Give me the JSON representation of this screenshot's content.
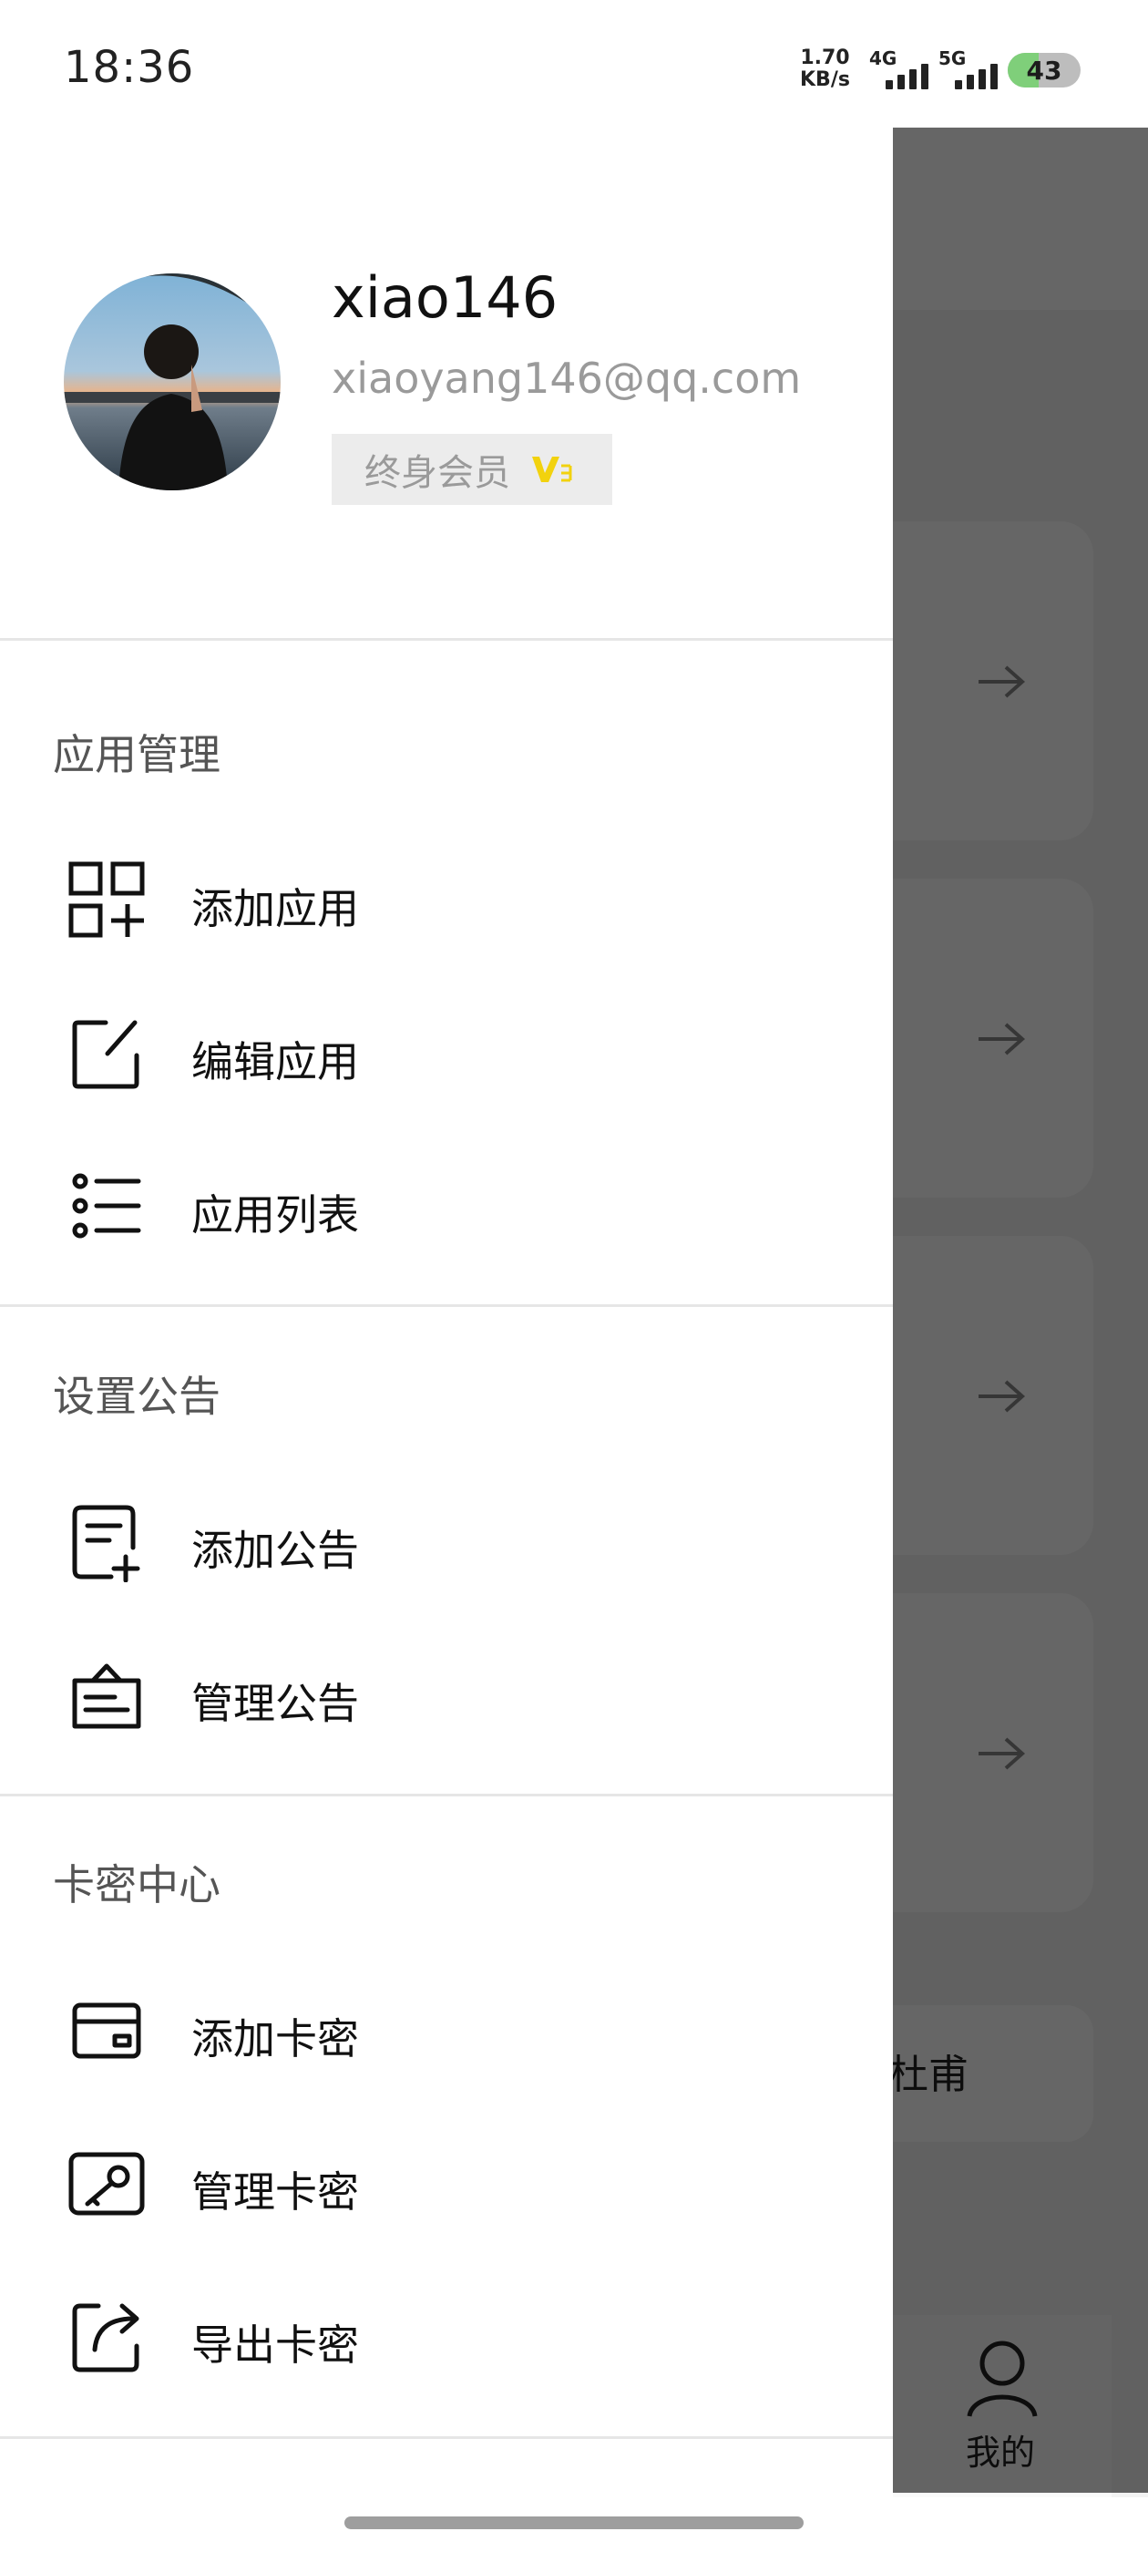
{
  "status_bar": {
    "time": "18:36",
    "net_speed_value": "1.70",
    "net_speed_unit": "KB/s",
    "signal_1_label": "4G",
    "signal_2_label": "5G",
    "battery_level": "43",
    "battery_fill_percent": 43,
    "battery_color": "#7fcf7a"
  },
  "background_page": {
    "card_text": "杜甫",
    "nav_label": "我的",
    "nav_icon": "person-icon"
  },
  "drawer": {
    "profile": {
      "username": "xiao146",
      "email": "xiaoyang146@qq.com",
      "membership": "终身会员",
      "vip_icon": "vip-badge-icon",
      "vip_color": "#f2d20e"
    },
    "sections": [
      {
        "title": "应用管理",
        "items": [
          {
            "label": "添加应用",
            "icon": "grid-add-icon"
          },
          {
            "label": "编辑应用",
            "icon": "edit-icon"
          },
          {
            "label": "应用列表",
            "icon": "list-icon"
          }
        ]
      },
      {
        "title": "设置公告",
        "items": [
          {
            "label": "添加公告",
            "icon": "note-add-icon"
          },
          {
            "label": "管理公告",
            "icon": "notice-board-icon"
          }
        ]
      },
      {
        "title": "卡密中心",
        "items": [
          {
            "label": "添加卡密",
            "icon": "card-icon"
          },
          {
            "label": "管理卡密",
            "icon": "card-key-icon"
          },
          {
            "label": "导出卡密",
            "icon": "export-icon"
          }
        ]
      }
    ]
  }
}
